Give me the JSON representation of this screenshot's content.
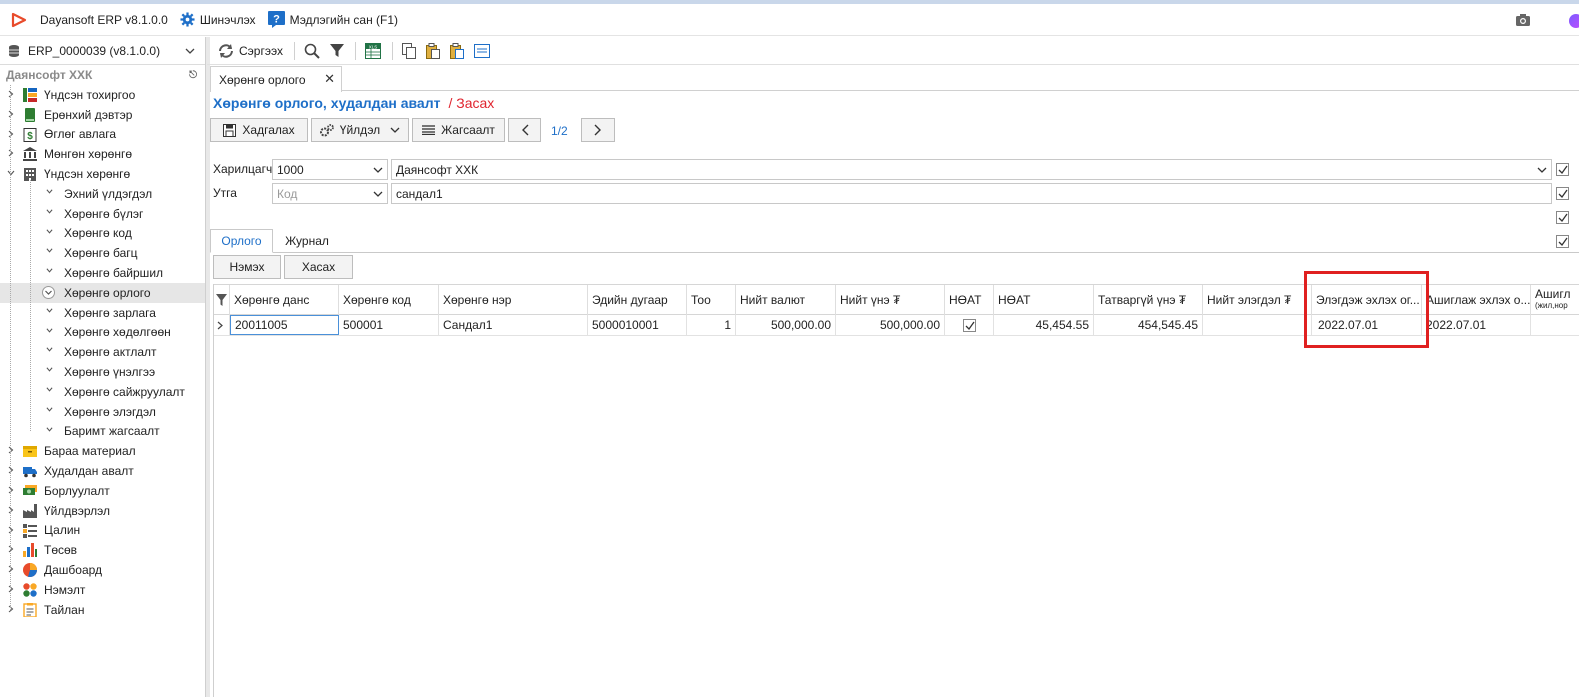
{
  "titlebar": {
    "app_name": "Dayansoft ERP v8.1.0.0",
    "update_label": "Шинэчлэх",
    "help_label": "Мэдлэгийн сан (F1)"
  },
  "sidebar": {
    "db_selector": "ERP_0000039 (v8.1.0.0)",
    "company": "Даянсофт ХХК",
    "items": [
      {
        "label": "Үндсэн тохиргоо",
        "icon": "settings-grid-icon"
      },
      {
        "label": "Ерөнхий дэвтэр",
        "icon": "ledger-book-icon"
      },
      {
        "label": "Өглөг авлага",
        "icon": "dollar-doc-icon"
      },
      {
        "label": "Мөнгөн хөрөнгө",
        "icon": "bank-icon"
      },
      {
        "label": "Үндсэн хөрөнгө",
        "icon": "building-icon"
      }
    ],
    "children": [
      "Эхний үлдэгдэл",
      "Хөрөнгө бүлэг",
      "Хөрөнгө код",
      "Хөрөнгө багц",
      "Хөрөнгө байршил",
      "Хөрөнгө орлого",
      "Хөрөнгө зарлага",
      "Хөрөнгө хөдөлгөөн",
      "Хөрөнгө актлалт",
      "Хөрөнгө үнэлгээ",
      "Хөрөнгө сайжруулалт",
      "Хөрөнгө элэгдэл",
      "Баримт жагсаалт"
    ],
    "items2": [
      {
        "label": "Бараа материал",
        "icon": "box-icon"
      },
      {
        "label": "Худалдан авалт",
        "icon": "truck-icon"
      },
      {
        "label": "Борлуулалт",
        "icon": "cash-icon"
      },
      {
        "label": "Үйлдвэрлэл",
        "icon": "factory-icon"
      },
      {
        "label": "Цалин",
        "icon": "payroll-icon"
      },
      {
        "label": "Төсөв",
        "icon": "bar-chart-icon"
      },
      {
        "label": "Дашбоард",
        "icon": "pie-chart-icon"
      },
      {
        "label": "Нэмэлт",
        "icon": "dots-icon"
      },
      {
        "label": "Тайлан",
        "icon": "report-icon"
      }
    ]
  },
  "toolbar": {
    "refresh_label": "Сэргээх"
  },
  "doc_tab": {
    "label": "Хөрөнгө орлого"
  },
  "form": {
    "title": "Хөрөнгө орлого, худалдан авалт",
    "mode": "/ Засах",
    "save_label": "Хадгалах",
    "action_label": "Үйлдэл",
    "list_label": "Жагсаалт",
    "pager": "1/2",
    "customer_label": "Харилцагч",
    "customer_code": "1000",
    "customer_name": "Даянсофт ХХК",
    "desc_label": "Утга",
    "desc_code_placeholder": "Код",
    "desc_value": "сандал1"
  },
  "subtabs": {
    "income": "Орлого",
    "journal": "Журнал",
    "add": "Нэмэх",
    "remove": "Хасах"
  },
  "grid": {
    "columns": [
      "Хөрөнгө данс",
      "Хөрөнгө код",
      "Хөрөнгө нэр",
      "Эдийн дугаар",
      "Тоо",
      "Нийт валют",
      "Нийт үнэ ₮",
      "НӨАТ",
      "НӨАТ",
      "Татваргүй үнэ ₮",
      "Нийт элэгдэл ₮",
      "Элэгдэж эхлэх ог...",
      "Ашиглаж эхлэх о...",
      "Ашигл"
    ],
    "col_extra": "(жил,нор",
    "row": {
      "account": "20011005",
      "code": "500001",
      "name": "Сандал1",
      "serial": "5000010001",
      "qty": "1",
      "total_currency": "500,000.00",
      "total_price": "500,000.00",
      "vat_checked": true,
      "vat": "45,454.55",
      "price_no_tax": "454,545.45",
      "total_depr": "",
      "depr_start": "2022.07.01",
      "use_start": "2022.07.01"
    }
  }
}
